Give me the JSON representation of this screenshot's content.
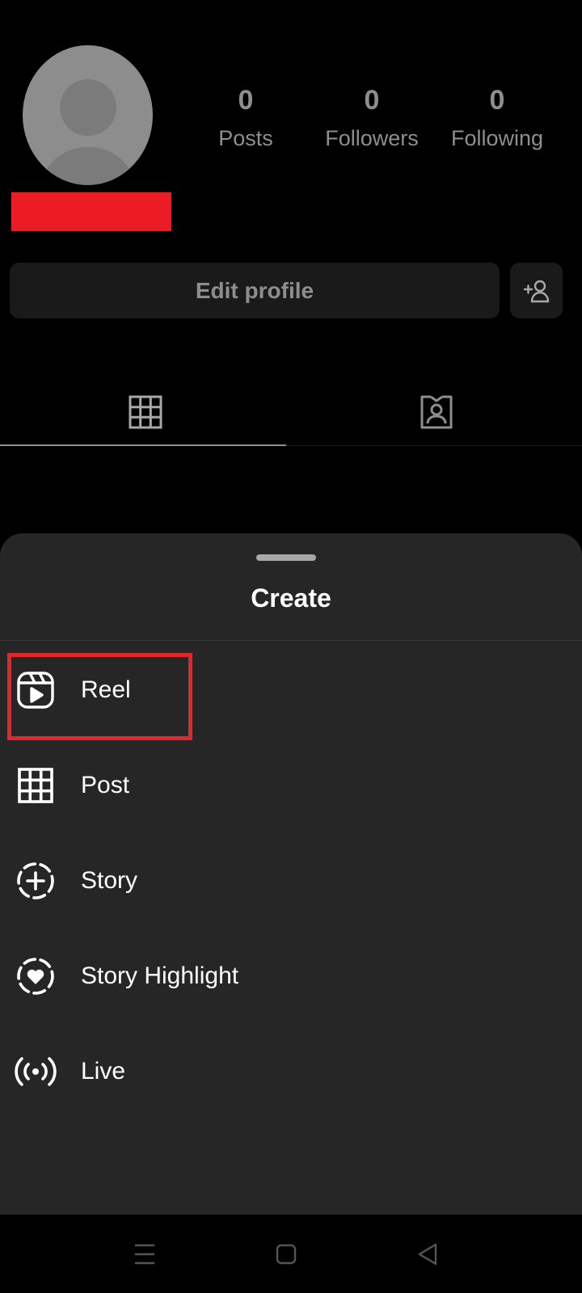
{
  "profile": {
    "stats": [
      {
        "value": "0",
        "label": "Posts"
      },
      {
        "value": "0",
        "label": "Followers"
      },
      {
        "value": "0",
        "label": "Following"
      }
    ],
    "edit_profile_label": "Edit profile"
  },
  "tabs": [
    {
      "icon": "grid-icon",
      "selected": true
    },
    {
      "icon": "tagged-person-icon",
      "selected": false
    }
  ],
  "create_sheet": {
    "title": "Create",
    "items": [
      {
        "label": "Reel",
        "icon": "reel-icon",
        "highlighted": true
      },
      {
        "label": "Post",
        "icon": "grid-icon"
      },
      {
        "label": "Story",
        "icon": "story-plus-icon"
      },
      {
        "label": "Story Highlight",
        "icon": "story-highlight-heart-icon"
      },
      {
        "label": "Live",
        "icon": "live-broadcast-icon"
      }
    ]
  },
  "navbar": {
    "buttons": [
      "menu-icon",
      "home-square-icon",
      "back-triangle-icon"
    ]
  },
  "colors": {
    "background": "#000000",
    "sheet": "#262626",
    "button_bg": "#1a1a1a",
    "muted_text": "#8e8e8e",
    "redaction": "#ec1c24",
    "highlight_box": "#e3262a"
  }
}
